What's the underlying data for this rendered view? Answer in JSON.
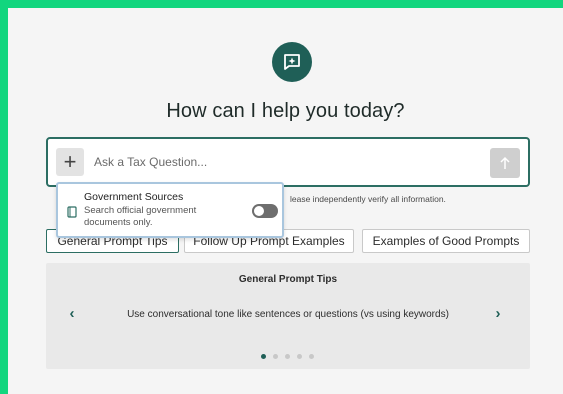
{
  "title": "How can I help you today?",
  "search": {
    "placeholder": "Ask a Tax Question...",
    "add_icon": "plus-icon",
    "send_icon": "arrow-up-icon"
  },
  "disclaimer": "lease independently verify all information.",
  "popup": {
    "icon": "book-icon",
    "title": "Government Sources",
    "description": "Search official government documents only.",
    "toggle_on": false
  },
  "tabs": [
    {
      "label": "General Prompt Tips",
      "active": true
    },
    {
      "label": "Follow Up Prompt Examples",
      "active": false
    },
    {
      "label": "Examples of Good Prompts",
      "active": false
    }
  ],
  "tips_panel": {
    "title": "General Prompt Tips",
    "tip": "Use conversational tone like sentences or questions (vs using keywords)",
    "prev_label": "‹",
    "next_label": "›",
    "page_count": 5,
    "current_page": 1
  },
  "colors": {
    "border_frame": "#12d67e",
    "accent": "#1f5f57"
  }
}
